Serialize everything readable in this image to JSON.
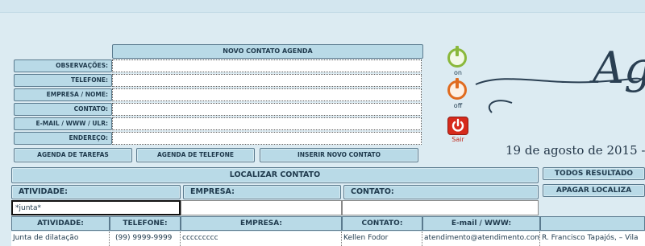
{
  "form": {
    "title": "NOVO CONTATO AGENDA",
    "labels": [
      "OBSERVAÇÕES:",
      "TELEFONE:",
      "EMPRESA / NOME:",
      "CONTATO:",
      "E-MAIL / WWW / ULR:",
      "ENDEREÇO:"
    ],
    "buttons": {
      "tasks": "AGENDA DE TAREFAS",
      "phonebook": "AGENDA DE TELEFONE",
      "insert": "INSERIR NOVO CONTATO"
    }
  },
  "controls": {
    "on_label": "on",
    "off_label": "off",
    "exit_label": "Sair"
  },
  "header": {
    "logo_script": "Ag",
    "date": "19 de agosto de 2015 -"
  },
  "search": {
    "title": "LOCALIZAR CONTATO",
    "filters": [
      "ATIVIDADE:",
      "EMPRESA:",
      "CONTATO:"
    ],
    "query": "*junta*",
    "all_results_button": "TODOS RESULTADO",
    "clear_button": "APAGAR LOCALIZA"
  },
  "table": {
    "columns": [
      "ATIVIDADE:",
      "TELEFONE:",
      "EMPRESA:",
      "CONTATO:",
      "E-mail / WWW:",
      ""
    ],
    "rows": [
      [
        "Junta de dilatação",
        "(99) 9999-9999",
        "ccccccccc",
        "Kellen Fodor",
        "atendimento@atendimento.com",
        "R. Francisco Tapajós,  – Vila"
      ]
    ]
  },
  "colors": {
    "accent": "#b9dae7",
    "background": "#dcebf2",
    "border": "#5a7a8e"
  }
}
